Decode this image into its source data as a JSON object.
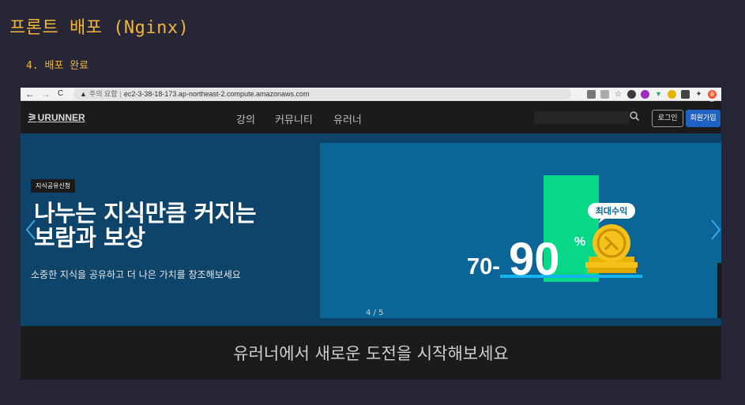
{
  "doc": {
    "title": "프론트 배포 (Nginx)",
    "step": "4. 배포 완료"
  },
  "browser": {
    "back": "←",
    "forward": "→",
    "reload": "C",
    "insecure_label": "주의 요함",
    "url": "ec2-3-38-18-173.ap-northeast-2.compute.amazonaws.com",
    "profile_badge": "솔라"
  },
  "site": {
    "logo": "URUNNER",
    "menu": [
      "강의",
      "커뮤니티",
      "유러너"
    ],
    "search_placeholder": "",
    "login_label": "로그인",
    "signup_label": "회원가입"
  },
  "hero": {
    "tag": "지식공유신청",
    "title_line1": "나누는 지식만큼 커지는",
    "title_line2": "보람과 보상",
    "subtitle": "소중한 지식을 공유하고 더 나은 가치를 창조해보세요",
    "badge": "최대수익",
    "prefix": "70-",
    "big_number": "90",
    "percent": "%",
    "page_indicator": "4 / 5"
  },
  "band": {
    "title": "유러너에서 새로운 도전을 시작해보세요"
  },
  "colors": {
    "doc_accent": "#f0b53a",
    "page_bg": "#262637",
    "hero_bg": "#0e4469",
    "banner_bg": "#0b6597",
    "green_bar": "#06d887",
    "cyan_line": "#15b3f0",
    "gold": "#f4c21a",
    "signup_blue": "#1e63c4"
  }
}
